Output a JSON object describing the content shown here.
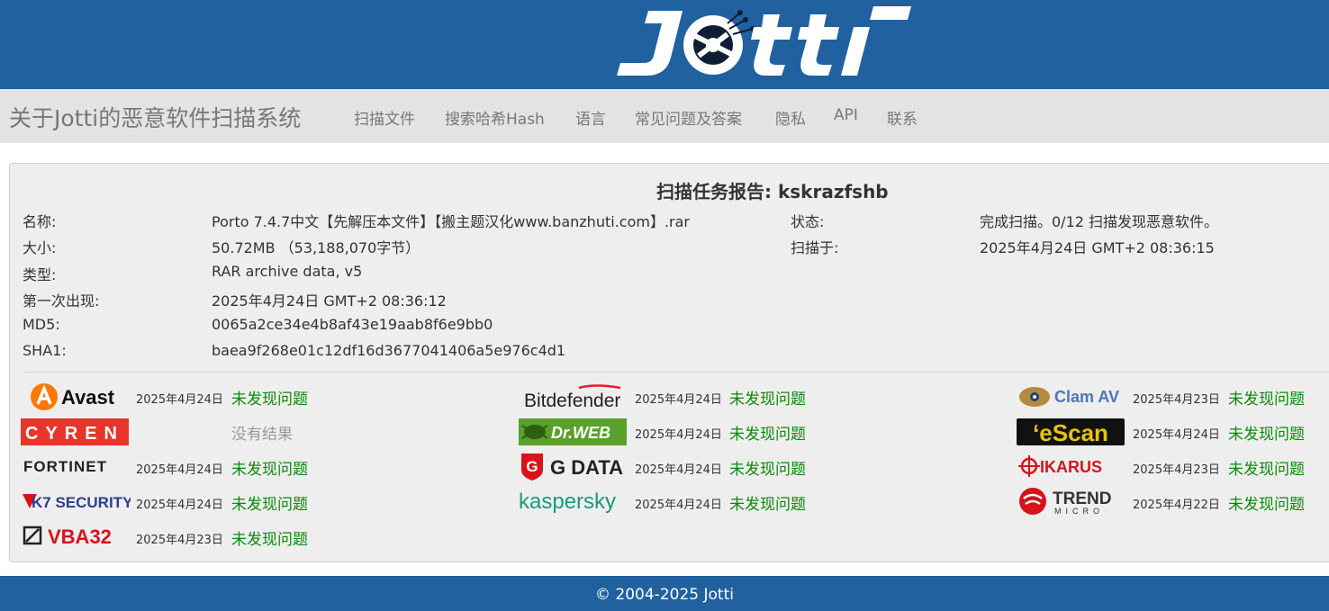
{
  "header": {
    "logo_text": "Jotti"
  },
  "nav": {
    "brand": "关于Jotti的恶意软件扫描系统",
    "items": [
      "扫描文件",
      "搜索哈希Hash",
      "语言",
      "常见问题及答案",
      "隐私",
      "API",
      "联系"
    ]
  },
  "report": {
    "title": "扫描任务报告: kskrazfshb",
    "left": [
      {
        "label": "名称:",
        "value": "Porto 7.4.7中文【先解压本文件】【搬主题汉化www.banzhuti.com】.rar"
      },
      {
        "label": "大小:",
        "value": "50.72MB （53,188,070字节）"
      },
      {
        "label": "类型:",
        "value": "RAR archive data, v5"
      },
      {
        "label": "第一次出现:",
        "value": "2025年4月24日 GMT+2 08:36:12"
      },
      {
        "label": "MD5:",
        "value": "0065a2ce34e4b8af43e19aab8f6e9bb0"
      },
      {
        "label": "SHA1:",
        "value": "baea9f268e01c12df16d3677041406a5e976c4d1"
      }
    ],
    "right": [
      {
        "label": "状态:",
        "value": "完成扫描。0/12 扫描发现恶意软件。"
      },
      {
        "label": "扫描于:",
        "value": "2025年4月24日 GMT+2 08:36:15"
      }
    ]
  },
  "scanners": [
    {
      "name": "Avast",
      "date": "2025年4月24日",
      "result": "未发现问题"
    },
    {
      "name": "Bitdefender",
      "date": "2025年4月24日",
      "result": "未发现问题"
    },
    {
      "name": "Clam AV",
      "date": "2025年4月23日",
      "result": "未发现问题"
    },
    {
      "name": "CYREN",
      "date": "",
      "result": "没有结果"
    },
    {
      "name": "Dr.WEB",
      "date": "2025年4月24日",
      "result": "未发现问题"
    },
    {
      "name": "eScan",
      "date": "2025年4月24日",
      "result": "未发现问题"
    },
    {
      "name": "FORTINET",
      "date": "2025年4月24日",
      "result": "未发现问题"
    },
    {
      "name": "G DATA",
      "date": "2025年4月24日",
      "result": "未发现问题"
    },
    {
      "name": "IKARUS",
      "date": "2025年4月23日",
      "result": "未发现问题"
    },
    {
      "name": "K7 SECURITY",
      "date": "2025年4月24日",
      "result": "未发现问题"
    },
    {
      "name": "kaspersky",
      "date": "2025年4月24日",
      "result": "未发现问题"
    },
    {
      "name": "TREND MICRO",
      "date": "2025年4月22日",
      "result": "未发现问题"
    },
    {
      "name": "VBA32",
      "date": "2025年4月23日",
      "result": "未发现问题"
    }
  ],
  "footer": {
    "copyright": "© 2004-2025 Jotti"
  },
  "colors": {
    "header_bg": "#21619f",
    "ok_green": "#0a8a0a",
    "none_gray": "#999999"
  }
}
